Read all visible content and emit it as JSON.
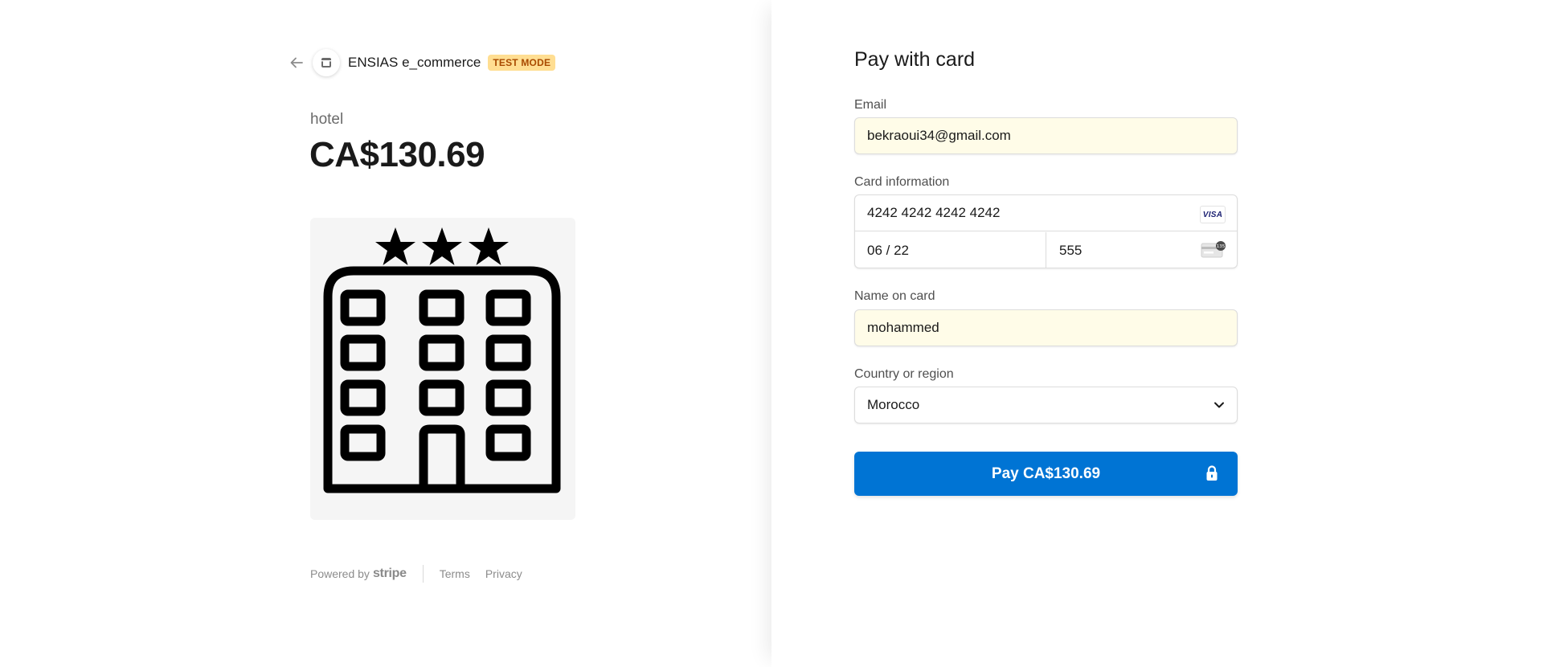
{
  "merchant": {
    "name": "ENSIAS e_commerce",
    "badge": "TEST MODE"
  },
  "product": {
    "name": "hotel",
    "price": "CA$130.69",
    "image_icon": "hotel-building-icon"
  },
  "footer": {
    "powered_by": "Powered by",
    "brand": "stripe",
    "terms": "Terms",
    "privacy": "Privacy"
  },
  "form": {
    "title": "Pay with card",
    "email_label": "Email",
    "email_value": "bekraoui34@gmail.com",
    "card_label": "Card information",
    "card_number": "4242 4242 4242 4242",
    "card_brand": "VISA",
    "card_expiry": "06 / 22",
    "card_cvc": "555",
    "cvc_icon_text": "135",
    "name_label": "Name on card",
    "name_value": "mohammed",
    "country_label": "Country or region",
    "country_value": "Morocco",
    "pay_button": "Pay CA$130.69"
  },
  "colors": {
    "accent": "#0074d4",
    "badge_bg": "#ffde92",
    "autofill_bg": "#fffce8"
  }
}
